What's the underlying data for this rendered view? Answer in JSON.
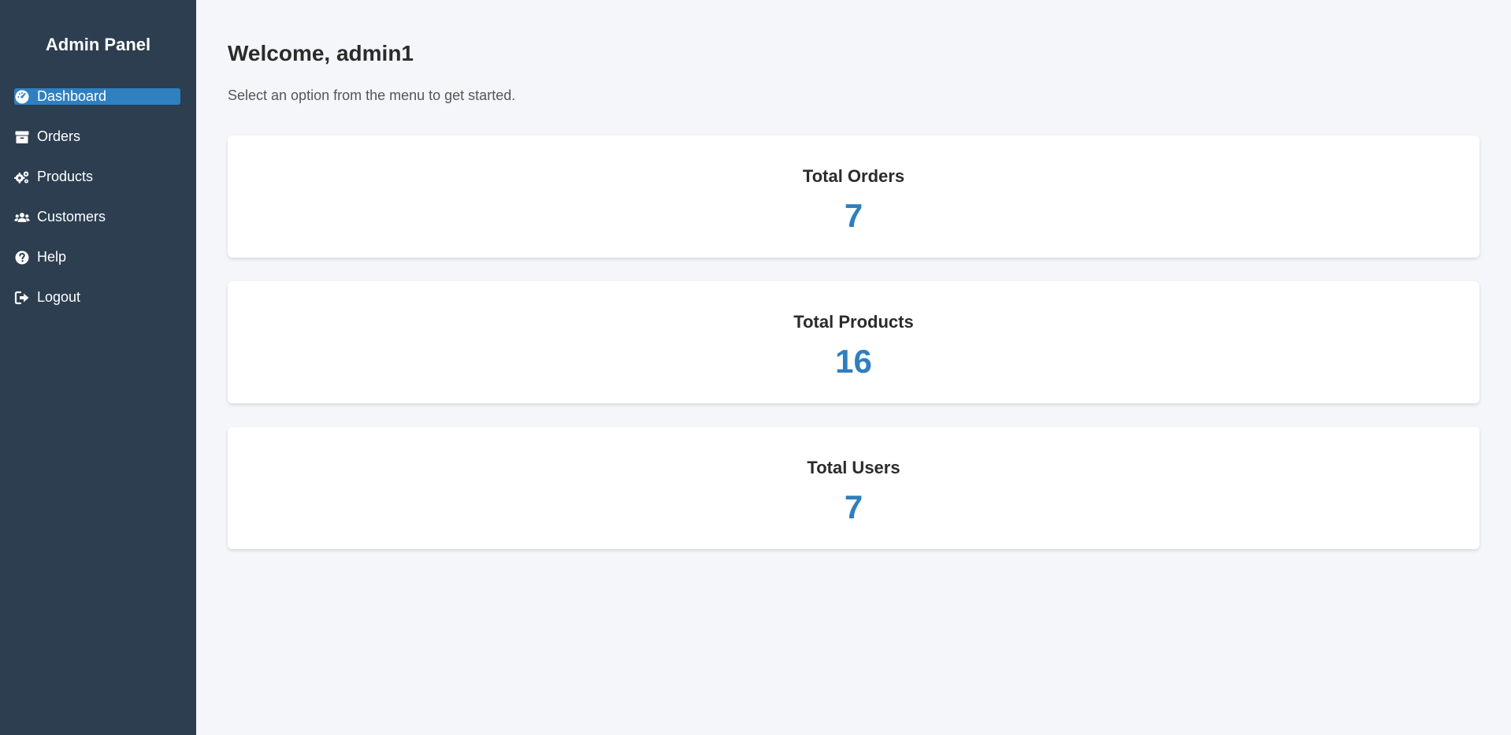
{
  "sidebar": {
    "brand": "Admin Panel",
    "items": [
      {
        "label": "Dashboard",
        "icon": "gauge-icon",
        "active": true
      },
      {
        "label": "Orders",
        "icon": "box-icon",
        "active": false
      },
      {
        "label": "Products",
        "icon": "cogs-icon",
        "active": false
      },
      {
        "label": "Customers",
        "icon": "users-icon",
        "active": false
      },
      {
        "label": "Help",
        "icon": "question-circle-icon",
        "active": false
      },
      {
        "label": "Logout",
        "icon": "sign-out-icon",
        "active": false
      }
    ]
  },
  "main": {
    "welcome": "Welcome, admin1",
    "subtitle": "Select an option from the menu to get started.",
    "cards": [
      {
        "title": "Total Orders",
        "value": "7"
      },
      {
        "title": "Total Products",
        "value": "16"
      },
      {
        "title": "Total Users",
        "value": "7"
      }
    ]
  },
  "colors": {
    "sidebar_bg": "#2c3e50",
    "active_item_bg": "#2f80c1",
    "stat_value": "#2e7fbf",
    "page_bg": "#f4f6fa"
  }
}
